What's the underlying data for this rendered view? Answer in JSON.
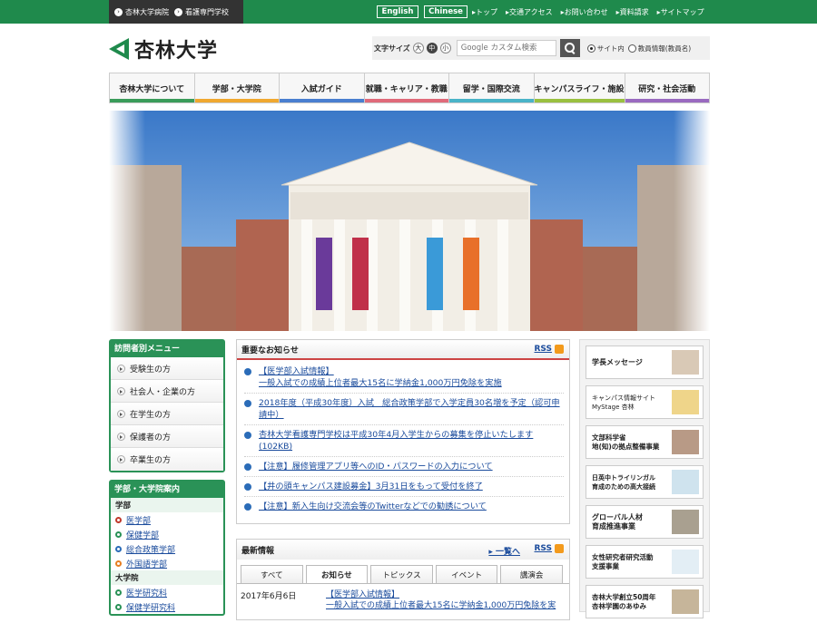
{
  "topbar": {
    "hospital": "杏林大学病院",
    "nursing_school": "看護専門学校",
    "lang_english": "English",
    "lang_chinese": "Chinese",
    "links": [
      "▸トップ",
      "▸交通アクセス",
      "▸お問い合わせ",
      "▸資料請求",
      "▸サイトマップ"
    ]
  },
  "logo": {
    "name": "杏林大学"
  },
  "search": {
    "font_size_label": "文字サイズ",
    "sizes": [
      "大",
      "中",
      "小"
    ],
    "placeholder": "Google カスタム検索",
    "scope_site": "サイト内",
    "scope_staff": "教員情報(教員名)"
  },
  "nav": [
    {
      "label": "杏林大学について",
      "color": "#3a9c5a"
    },
    {
      "label": "学部・大学院",
      "color": "#f0a830"
    },
    {
      "label": "入試ガイド",
      "color": "#4a7fd0"
    },
    {
      "label": "就職・キャリア・教職",
      "color": "#e06a7a"
    },
    {
      "label": "留学・国際交流",
      "color": "#4ab4c8"
    },
    {
      "label": "キャンパスライフ・施設",
      "color": "#9ac040"
    },
    {
      "label": "研究・社会活動",
      "color": "#9a6ac0"
    }
  ],
  "visitor_menu": {
    "title": "訪問者別メニュー",
    "items": [
      "受験生の方",
      "社会人・企業の方",
      "在学生の方",
      "保護者の方",
      "卒業生の方"
    ]
  },
  "faculty_guide": {
    "title": "学部・大学院案内",
    "undergrad_label": "学部",
    "undergrad": [
      {
        "label": "医学部",
        "color": "#c0392b"
      },
      {
        "label": "保健学部",
        "color": "#2a9257"
      },
      {
        "label": "総合政策学部",
        "color": "#2b6cb8"
      },
      {
        "label": "外国語学部",
        "color": "#e67e22"
      }
    ],
    "grad_label": "大学院",
    "grad": [
      {
        "label": "医学研究科",
        "color": "#2a9257"
      },
      {
        "label": "保健学研究科",
        "color": "#2a9257"
      }
    ]
  },
  "important": {
    "title": "重要なお知らせ",
    "rss": "RSS",
    "items": [
      "【医学部入試情報】\n一般入試での成績上位者最大15名に学納金1,000万円免除を実施",
      "2018年度（平成30年度）入試　総合政策学部で入学定員30名増を予定（認可申請中）",
      "杏林大学看護専門学校は平成30年4月入学生からの募集を停止いたします(102KB)",
      "【注意】履修管理アプリ等へのID・パスワードの入力について",
      "【井の頭キャンパス建設募金】3月31日をもって受付を終了",
      "【注意】新入生向け交流会等のTwitterなどでの勧誘について"
    ]
  },
  "latest": {
    "title": "最新情報",
    "list_link": "▸ 一覧へ",
    "rss": "RSS",
    "tabs": [
      "すべて",
      "お知らせ",
      "トピックス",
      "イベント",
      "講演会"
    ],
    "entry_date": "2017年6月6日",
    "entry_title": "【医学部入試情報】",
    "entry_sub": "一般入試での成績上位者最大15名に学納金1,000万円免除を実"
  },
  "banners": [
    "学長メッセージ",
    "キャンパス情報サイト\nMyStage 杏林",
    "文部科学省\n地(知)の拠点整備事業",
    "日英中トライリンガル\n育成のための高大接続",
    "グローバル人材\n育成推進事業",
    "女性研究者研究活動\n支援事業",
    "杏林大学創立50周年\n杏林学園のあゆみ"
  ],
  "colors": {
    "brand_green": "#1f8a4c",
    "link_blue": "#1a4b9c",
    "accent_red": "#c44"
  }
}
